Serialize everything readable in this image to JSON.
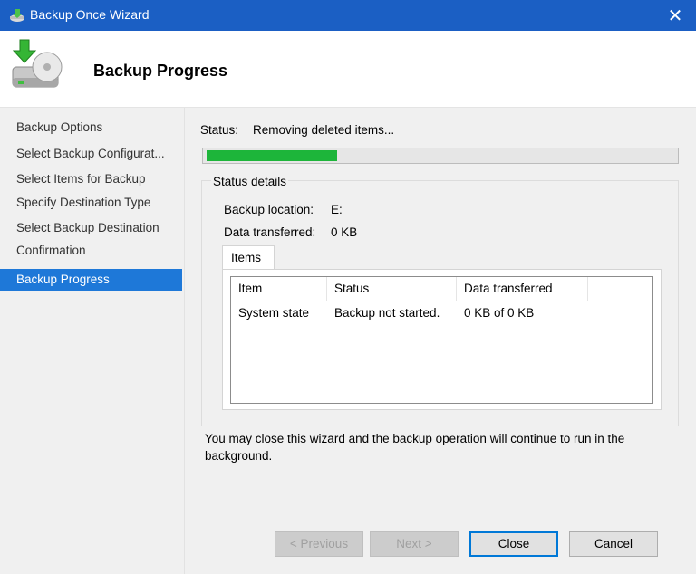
{
  "window": {
    "title": "Backup Once Wizard",
    "close_glyph": "✕"
  },
  "header": {
    "title": "Backup Progress",
    "icon": "backup-drive-icon"
  },
  "sidebar": {
    "items": [
      {
        "label": "Backup Options",
        "active": false
      },
      {
        "label": "Select Backup Configurat...",
        "active": false
      },
      {
        "label": "Select Items for Backup",
        "active": false
      },
      {
        "label": "Specify Destination Type",
        "active": false
      },
      {
        "label": "Select Backup Destination",
        "active": false
      },
      {
        "label": "Confirmation",
        "active": false
      },
      {
        "label": "Backup Progress",
        "active": true
      }
    ]
  },
  "status": {
    "label": "Status:",
    "value": "Removing deleted items...",
    "progress_fraction": 0.28
  },
  "details": {
    "legend": "Status details",
    "location_label": "Backup location:",
    "location_value": "E:",
    "transferred_label": "Data transferred:",
    "transferred_value": "0 KB",
    "tab_label": "Items",
    "table": {
      "columns": [
        "Item",
        "Status",
        "Data transferred"
      ],
      "rows": [
        [
          "System state",
          "Backup not started.",
          "0 KB of 0 KB"
        ]
      ]
    }
  },
  "note": "You may close this wizard and the backup operation will continue to run in the background.",
  "buttons": {
    "previous": "< Previous",
    "next": "Next >",
    "close": "Close",
    "cancel": "Cancel"
  },
  "colors": {
    "titlebar": "#1b5fc4",
    "progress": "#1db53a",
    "active_item": "#1e78d8"
  }
}
